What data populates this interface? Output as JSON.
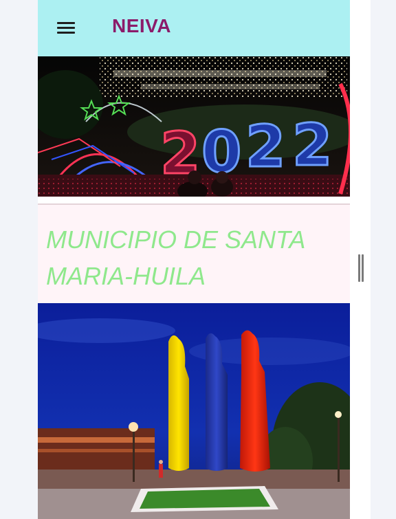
{
  "appbar": {
    "brand": "NEIVA",
    "menu_icon": "hamburger-menu-icon",
    "background": "#acf0f2",
    "brand_color": "#8b1b6a"
  },
  "hero_top": {
    "year_text": "2022"
  },
  "section": {
    "title": "MUNICIPIO DE SANTA MARIA-HUILA",
    "title_color": "#8fe88c",
    "background": "#fff4f8"
  },
  "scrollbar": {
    "icon": "drag-handle-icon"
  }
}
